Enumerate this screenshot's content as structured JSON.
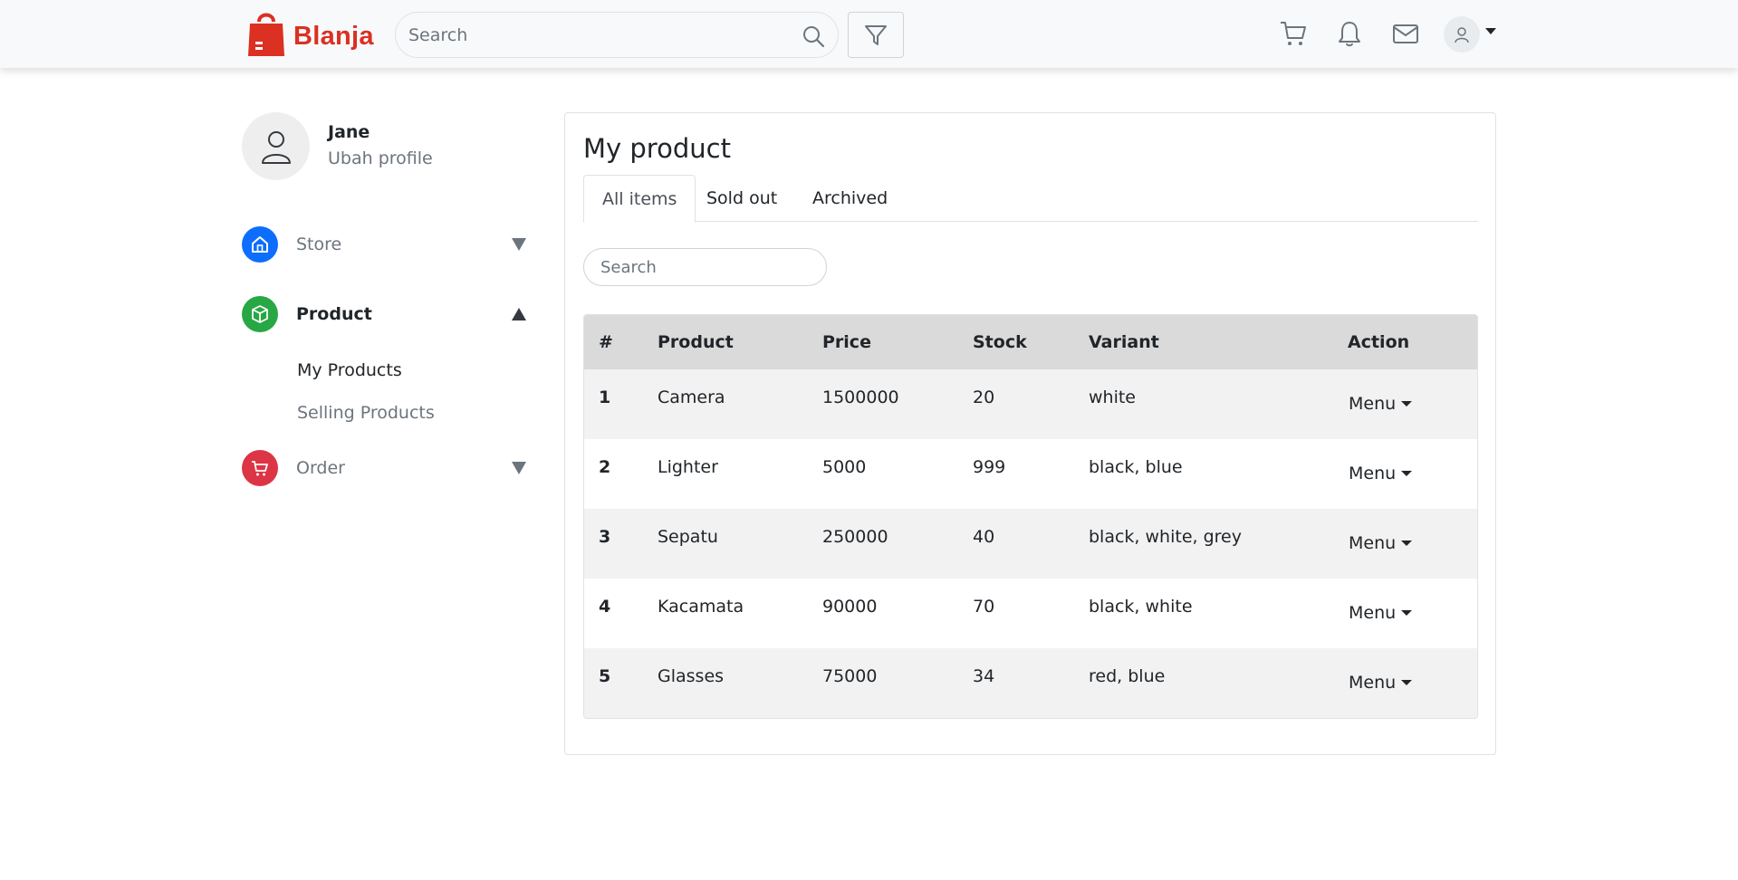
{
  "navbar": {
    "brand": "Blanja",
    "search_placeholder": "Search",
    "icons": [
      "cart-icon",
      "bell-icon",
      "mail-icon",
      "user-icon"
    ]
  },
  "profile": {
    "name": "Jane",
    "edit_label": "Ubah profile"
  },
  "sidebar": {
    "items": [
      {
        "label": "Store",
        "icon": "store-icon",
        "color": "#0d6efd",
        "expanded": false
      },
      {
        "label": "Product",
        "icon": "box-icon",
        "color": "#28a745",
        "expanded": true
      },
      {
        "label": "Order",
        "icon": "cart-icon",
        "color": "#dc3545",
        "expanded": false
      }
    ],
    "product_sub": [
      "My Products",
      "Selling Products"
    ]
  },
  "main": {
    "title": "My product",
    "tabs": [
      "All items",
      "Sold out",
      "Archived"
    ],
    "active_tab": "All items",
    "search_placeholder": "Search",
    "table": {
      "headers": [
        "#",
        "Product",
        "Price",
        "Stock",
        "Variant",
        "Action"
      ],
      "rows": [
        {
          "no": "1",
          "product": "Camera",
          "price": "1500000",
          "stock": "20",
          "variant": "white",
          "action": "Menu"
        },
        {
          "no": "2",
          "product": "Lighter",
          "price": "5000",
          "stock": "999",
          "variant": "black, blue",
          "action": "Menu"
        },
        {
          "no": "3",
          "product": "Sepatu",
          "price": "250000",
          "stock": "40",
          "variant": "black, white, grey",
          "action": "Menu"
        },
        {
          "no": "4",
          "product": "Kacamata",
          "price": "90000",
          "stock": "70",
          "variant": "black, white",
          "action": "Menu"
        },
        {
          "no": "5",
          "product": "Glasses",
          "price": "75000",
          "stock": "34",
          "variant": "red, blue",
          "action": "Menu"
        }
      ]
    }
  },
  "colors": {
    "brand": "#db3022",
    "store": "#0d6efd",
    "product": "#28a745",
    "order": "#dc3545"
  }
}
